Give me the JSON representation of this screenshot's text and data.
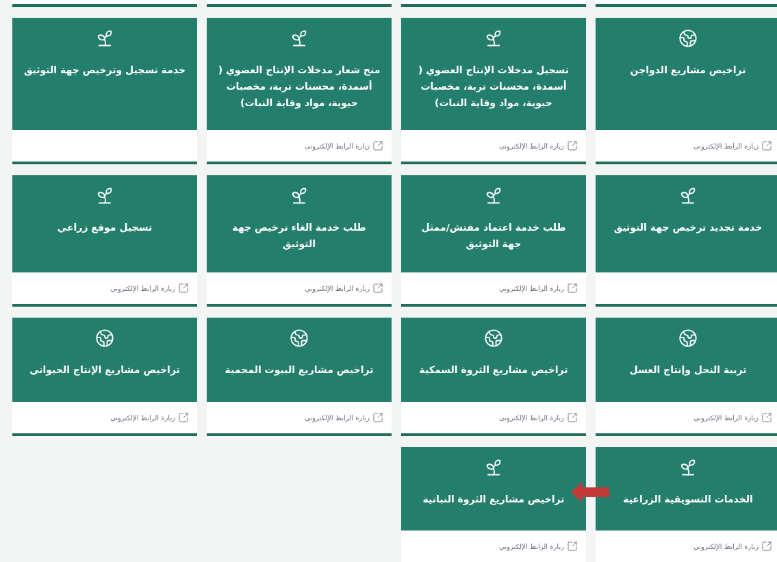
{
  "rows": [
    [
      {
        "kind": "globe",
        "title": "تراخيص مشاريع الدواجن",
        "link": "زيارة الرابط الإلكتروني",
        "marked": false
      },
      {
        "kind": "sprout",
        "title": "تسجيل مدخلات الإنتاج العضوي ( أسمدة، محسنات تربة، مخصبات حيوية، مواد وقاية النبات)",
        "link": "زيارة الرابط الإلكتروني",
        "marked": false
      },
      {
        "kind": "sprout",
        "title": "منح شعار مدخلات الإنتاج العضوي ( أسمدة، محسنات تربة، مخصبات حيوية، مواد وقاية النبات)",
        "link": "زيارة الرابط الإلكتروني",
        "marked": false
      },
      {
        "kind": "sprout",
        "title": "خدمة تسجيل وترخيص جهة التوثيق",
        "marked": false
      }
    ],
    [
      {
        "kind": "sprout",
        "title": "خدمة تجديد ترخيص جهة التوثيق",
        "marked": false
      },
      {
        "kind": "sprout",
        "title": "طلب خدمة اعتماد مفتش/ممثل جهة التوثيق",
        "link": "زيارة الرابط الإلكتروني",
        "marked": false
      },
      {
        "kind": "sprout",
        "title": "طلب خدمة الغاء ترخيص جهة التوثيق",
        "link": "زيارة الرابط الإلكتروني",
        "marked": false
      },
      {
        "kind": "sprout",
        "title": "تسجيل موقع زراعي",
        "link": "زيارة الرابط الإلكتروني",
        "marked": false
      }
    ],
    [
      {
        "kind": "globe",
        "title": "تربية النحل وإنتاج العسل",
        "link": "زيارة الرابط الإلكتروني",
        "marked": false
      },
      {
        "kind": "globe",
        "title": "تراخيص مشاريع الثروة السمكية",
        "link": "زيارة الرابط الإلكتروني",
        "marked": false
      },
      {
        "kind": "globe",
        "title": "تراخيص مشاريع البيوت المحمية",
        "link": "زيارة الرابط الإلكتروني",
        "marked": false
      },
      {
        "kind": "globe",
        "title": "تراخيص مشاريع الإنتاج الحيواني",
        "link": "زيارة الرابط الإلكتروني",
        "marked": false
      }
    ],
    [
      {
        "kind": "sprout",
        "title": "الخدمات التسويقية الزراعية",
        "link": "زيارة الرابط الإلكتروني",
        "marked": false
      },
      {
        "kind": "sprout",
        "title": "تراخيص مشاريع الثروة النباتية",
        "link": "زيارة الرابط الإلكتروني",
        "marked": true
      }
    ]
  ]
}
